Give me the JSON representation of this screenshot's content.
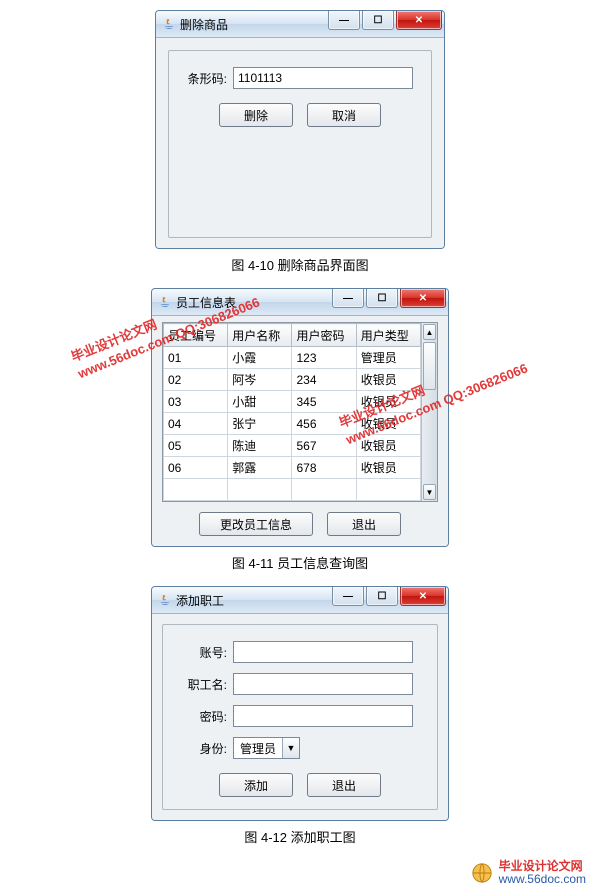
{
  "captions": {
    "fig1": "图 4-10 删除商品界面图",
    "fig2": "图 4-11 员工信息查询图",
    "fig3": "图 4-12 添加职工图"
  },
  "win1": {
    "title": "删除商品",
    "barcode_label": "条形码:",
    "barcode_value": "1101113",
    "btn_delete": "删除",
    "btn_cancel": "取消"
  },
  "win2": {
    "title": "员工信息表",
    "headers": {
      "id": "员工编号",
      "name": "用户名称",
      "pwd": "用户密码",
      "type": "用户类型"
    },
    "rows": [
      {
        "id": "01",
        "name": "小霞",
        "pwd": "123",
        "type": "管理员"
      },
      {
        "id": "02",
        "name": "阿岑",
        "pwd": "234",
        "type": "收银员"
      },
      {
        "id": "03",
        "name": "小甜",
        "pwd": "345",
        "type": "收银员"
      },
      {
        "id": "04",
        "name": "张宁",
        "pwd": "456",
        "type": "收银员"
      },
      {
        "id": "05",
        "name": "陈迪",
        "pwd": "567",
        "type": "收银员"
      },
      {
        "id": "06",
        "name": "郭露",
        "pwd": "678",
        "type": "收银员"
      }
    ],
    "btn_modify": "更改员工信息",
    "btn_exit": "退出"
  },
  "win3": {
    "title": "添加职工",
    "label_account": "账号:",
    "label_name": "职工名:",
    "label_pwd": "密码:",
    "label_role": "身份:",
    "role_value": "管理员",
    "btn_add": "添加",
    "btn_exit": "退出"
  },
  "icons": {
    "min_glyph": "—",
    "max_glyph": "☐",
    "close_glyph": "✕",
    "dropdown_glyph": "▼",
    "up_glyph": "▲",
    "down_glyph": "▼"
  },
  "watermark": {
    "line1": "毕业设计论文网",
    "line2": "www.56doc.com   QQ:306826066"
  },
  "footer": {
    "brand1": "毕业设计论文网",
    "brand2": "www.56doc.com"
  }
}
